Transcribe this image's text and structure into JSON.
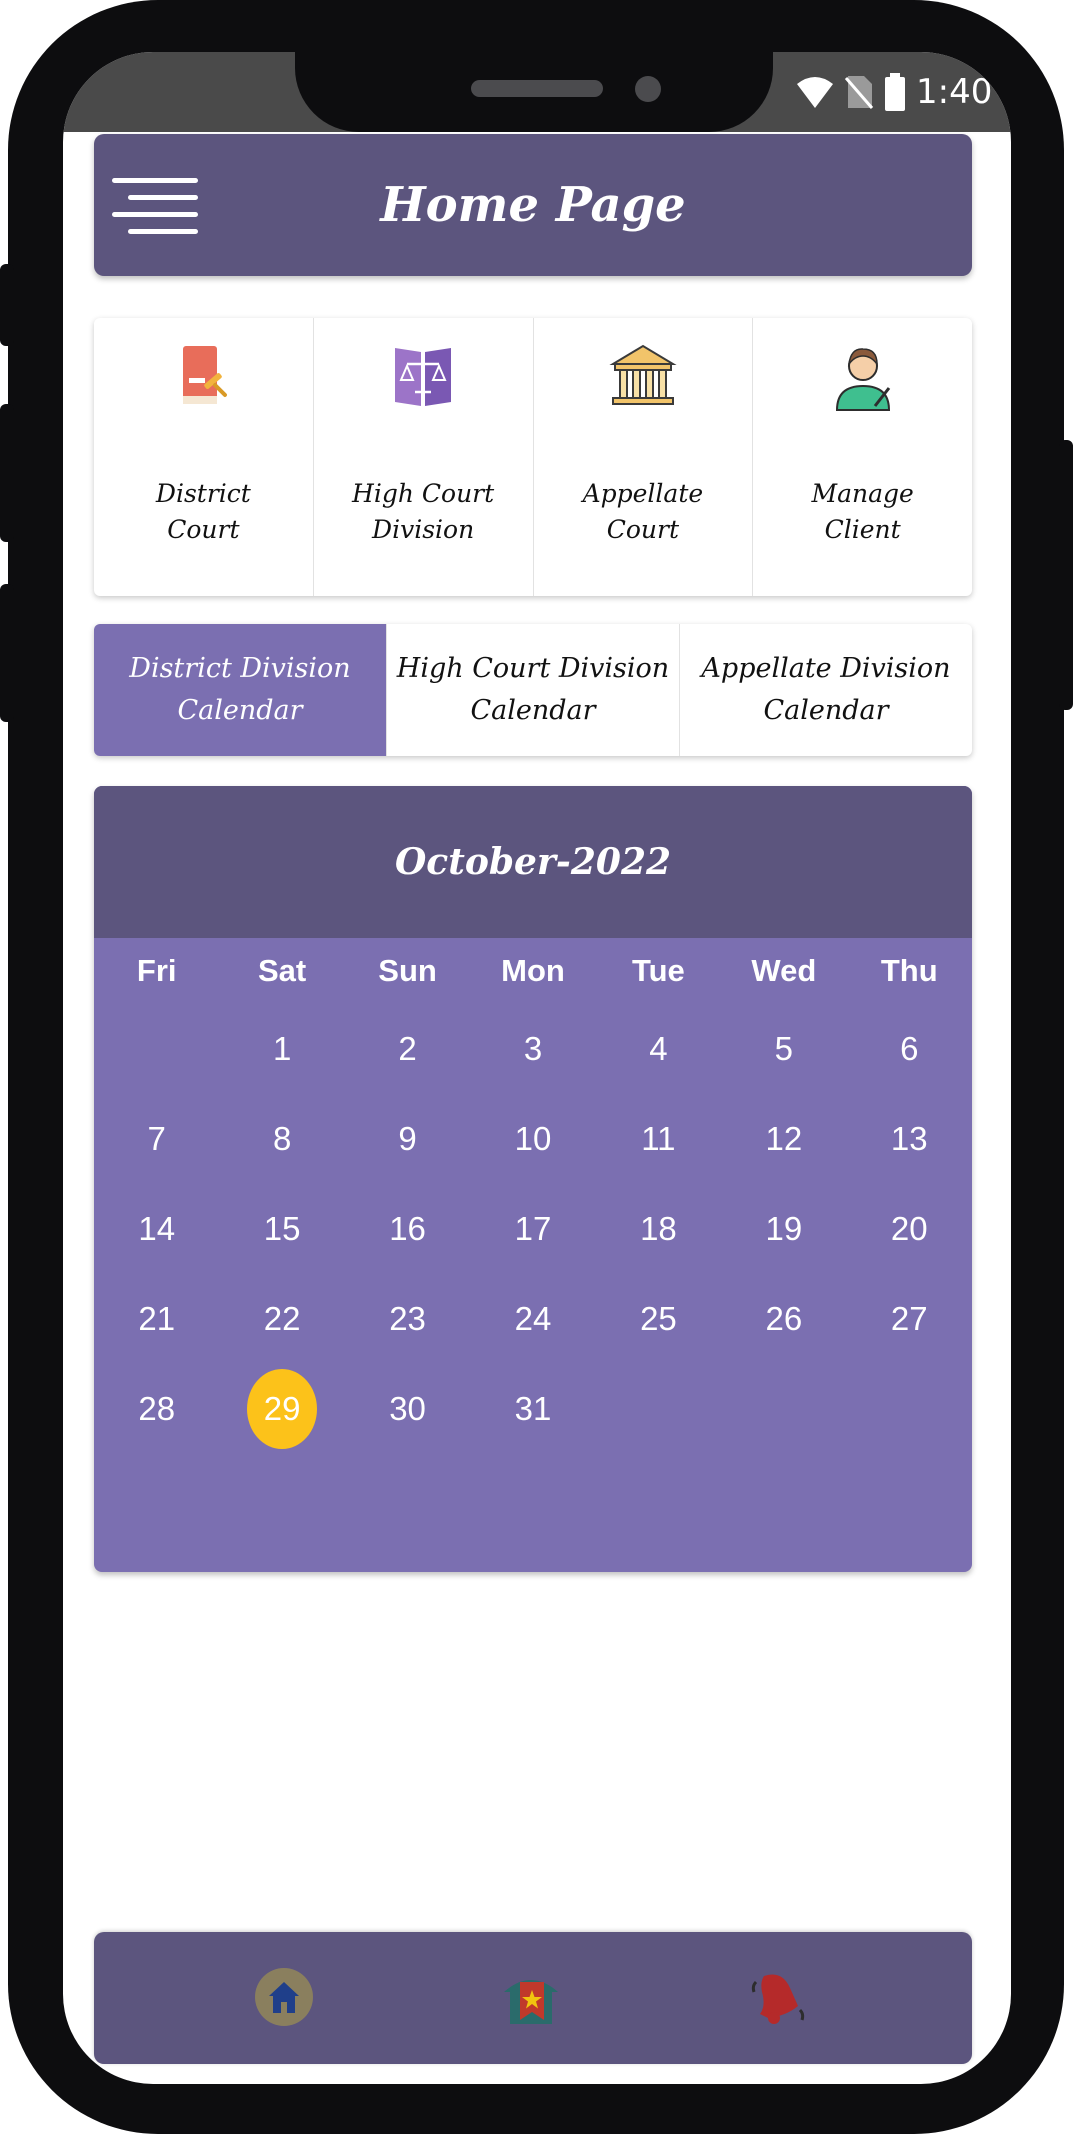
{
  "status_bar": {
    "time": "1:40"
  },
  "header": {
    "title": "Home Page"
  },
  "categories": [
    {
      "label": "District\nCourt",
      "icon": "law-book-gavel-icon"
    },
    {
      "label": "High Court\nDivision",
      "icon": "law-book-scales-icon"
    },
    {
      "label": "Appellate\nCourt",
      "icon": "courthouse-icon"
    },
    {
      "label": "Manage\nClient",
      "icon": "client-avatar-icon"
    }
  ],
  "calendar_tabs": [
    {
      "label": "District Division\nCalendar",
      "active": true
    },
    {
      "label": "High Court Division\nCalendar",
      "active": false
    },
    {
      "label": "Appellate Division\nCalendar",
      "active": false
    }
  ],
  "calendar": {
    "month_label": "October-2022",
    "weekdays": [
      "Fri",
      "Sat",
      "Sun",
      "Mon",
      "Tue",
      "Wed",
      "Thu"
    ],
    "first_day_offset": 1,
    "days_in_month": 31,
    "selected_day": 29
  },
  "bottom_nav": [
    {
      "icon": "home-icon"
    },
    {
      "icon": "court-flag-icon"
    },
    {
      "icon": "notification-bell-icon"
    }
  ],
  "colors": {
    "primary_dark": "#5c557e",
    "primary": "#7b6fb1",
    "highlight": "#fcc21a"
  }
}
